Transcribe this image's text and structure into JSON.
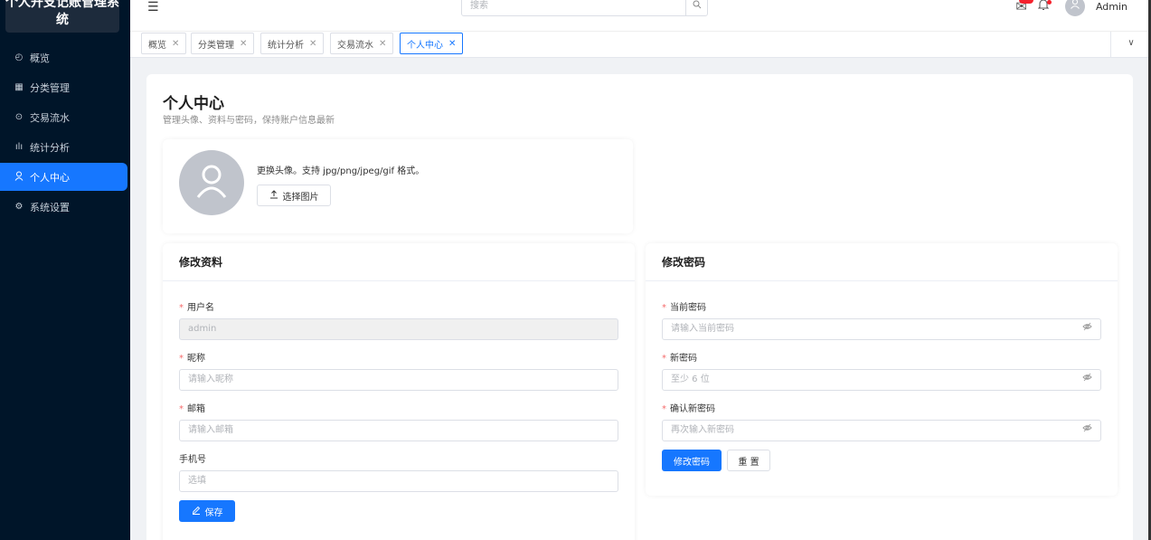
{
  "app": {
    "title": "个人开支记账管理系统"
  },
  "sidebar": {
    "items": [
      {
        "icon": "dashboard-icon",
        "label": "概览",
        "active": false
      },
      {
        "icon": "grid-icon",
        "label": "分类管理",
        "active": false
      },
      {
        "icon": "transaction-icon",
        "label": "交易流水",
        "active": false
      },
      {
        "icon": "chart-icon",
        "label": "统计分析",
        "active": false
      },
      {
        "icon": "user-icon",
        "label": "个人中心",
        "active": true
      },
      {
        "icon": "gear-icon",
        "label": "系统设置",
        "active": false
      }
    ]
  },
  "header": {
    "search_placeholder": "搜索",
    "user_name": "Admin"
  },
  "tabs": [
    {
      "label": "概览",
      "active": false
    },
    {
      "label": "分类管理",
      "active": false
    },
    {
      "label": "统计分析",
      "active": false
    },
    {
      "label": "交易流水",
      "active": false
    },
    {
      "label": "个人中心",
      "active": true
    }
  ],
  "page": {
    "title": "个人中心",
    "subtitle": "管理头像、资料与密码，保持账户信息最新"
  },
  "avatar": {
    "hint": "更换头像。支持 jpg/png/jpeg/gif 格式。",
    "pick_label": "选择图片"
  },
  "profile": {
    "title": "修改资料",
    "username_label": "用户名",
    "username_value": "admin",
    "nickname_label": "昵称",
    "nickname_placeholder": "请输入昵称",
    "email_label": "邮箱",
    "email_placeholder": "请输入邮箱",
    "phone_label": "手机号",
    "phone_placeholder": "选填",
    "save_label": "保存"
  },
  "password": {
    "title": "修改密码",
    "current_label": "当前密码",
    "current_placeholder": "请输入当前密码",
    "new_label": "新密码",
    "new_placeholder": "至少 6 位",
    "confirm_label": "确认新密码",
    "confirm_placeholder": "再次输入新密码",
    "submit_label": "修改密码",
    "reset_label": "重 置"
  },
  "colors": {
    "primary": "#1677ff",
    "sidebar_bg": "#001529",
    "required": "#f56c6c"
  }
}
